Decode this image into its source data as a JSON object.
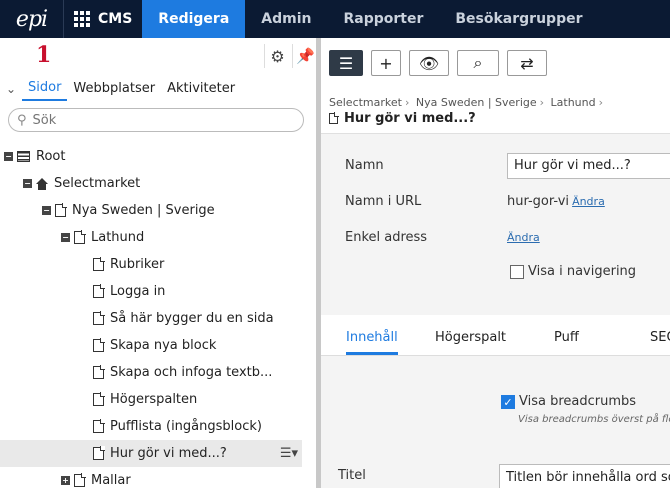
{
  "topbar": {
    "logo": "epi",
    "app": "CMS",
    "nav": [
      "Redigera",
      "Admin",
      "Rapporter",
      "Besökargrupper"
    ]
  },
  "left": {
    "marker": "1",
    "tabs": [
      "Sidor",
      "Webbplatser",
      "Aktiviteter"
    ],
    "search_placeholder": "Sök",
    "tree": [
      {
        "label": "Root",
        "level": 0,
        "toggle": "minus",
        "icon": "root-icon"
      },
      {
        "label": "Selectmarket",
        "level": 1,
        "toggle": "minus",
        "icon": "home-icon"
      },
      {
        "label": "Nya Sweden | Sverige",
        "level": 2,
        "toggle": "minus",
        "icon": "page-icon"
      },
      {
        "label": "Lathund",
        "level": 3,
        "toggle": "minus",
        "icon": "page-icon"
      },
      {
        "label": "Rubriker",
        "level": 4,
        "icon": "page-icon"
      },
      {
        "label": "Logga in",
        "level": 4,
        "icon": "page-icon"
      },
      {
        "label": "Så här bygger du en sida",
        "level": 4,
        "icon": "page-icon"
      },
      {
        "label": "Skapa nya block",
        "level": 4,
        "icon": "page-icon"
      },
      {
        "label": "Skapa och infoga textb...",
        "level": 4,
        "icon": "page-icon"
      },
      {
        "label": "Högerspalten",
        "level": 4,
        "icon": "page-icon"
      },
      {
        "label": "Pufflista (ingångsblock)",
        "level": 4,
        "icon": "page-icon"
      },
      {
        "label": "Hur gör vi med...?",
        "level": 4,
        "icon": "page-icon",
        "selected": true
      },
      {
        "label": "Mallar",
        "level": 3,
        "toggle": "plus",
        "icon": "page-icon"
      }
    ]
  },
  "right": {
    "breadcrumb": [
      "Selectmarket",
      "Nya Sweden | Sverige",
      "Lathund"
    ],
    "page_title": "Hur gör vi med...?",
    "form": {
      "name_label": "Namn",
      "name_value": "Hur gör vi med...?",
      "url_label": "Namn i URL",
      "url_value": "hur-gor-vi",
      "change_link": "Ändra",
      "simple_label": "Enkel adress",
      "nav_checkbox": "Visa i navigering"
    },
    "content_tabs": [
      "Innehåll",
      "Högerspalt",
      "Puff",
      "SEO"
    ],
    "breadcrumbs_checkbox": "Visa breadcrumbs",
    "breadcrumbs_hint": "Visa breadcrumbs överst på fler",
    "title_label": "Titel",
    "title_value": "Titlen bör innehålla ord som"
  }
}
